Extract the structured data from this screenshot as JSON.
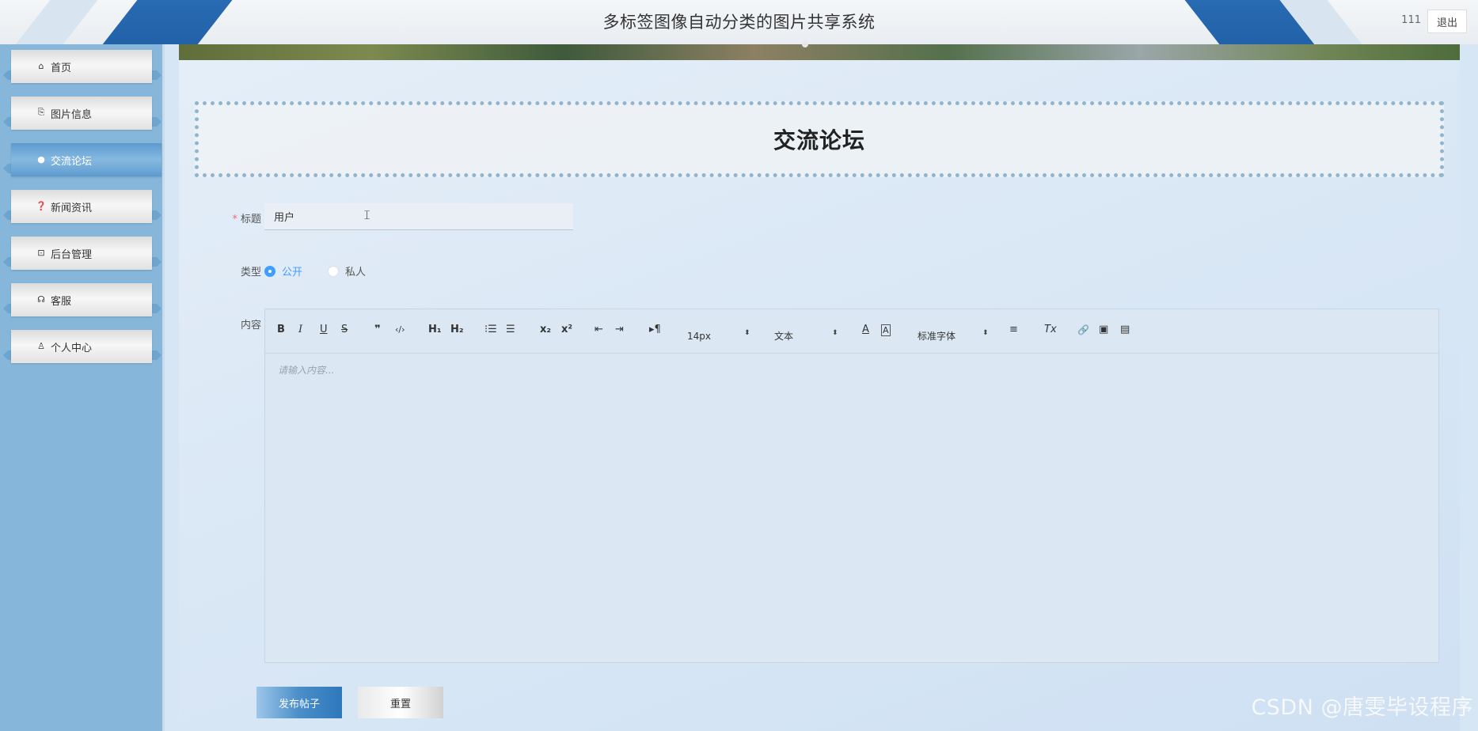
{
  "header": {
    "title": "多标签图像自动分类的图片共享系统",
    "username": "111",
    "logout_label": "退出"
  },
  "sidebar": {
    "items": [
      {
        "label": "首页",
        "icon": "home-icon",
        "active": false
      },
      {
        "label": "图片信息",
        "icon": "bag-icon",
        "active": false
      },
      {
        "label": "交流论坛",
        "icon": "info-icon",
        "active": true
      },
      {
        "label": "新闻资讯",
        "icon": "question-icon",
        "active": false
      },
      {
        "label": "后台管理",
        "icon": "box-icon",
        "active": false
      },
      {
        "label": "客服",
        "icon": "headset-icon",
        "active": false
      },
      {
        "label": "个人中心",
        "icon": "user-icon",
        "active": false
      }
    ]
  },
  "page": {
    "heading": "交流论坛"
  },
  "form": {
    "title_label": "标题",
    "title_required_mark": "*",
    "title_value": "用户",
    "type_label": "类型",
    "type_options": [
      {
        "label": "公开",
        "selected": true
      },
      {
        "label": "私人",
        "selected": false
      }
    ],
    "content_label": "内容",
    "content_placeholder": "请输入内容...",
    "submit_label": "发布帖子",
    "reset_label": "重置"
  },
  "editor_toolbar": {
    "bold": "B",
    "italic": "I",
    "underline": "U",
    "strike": "S",
    "blockquote": "❞",
    "code": "‹/›",
    "h1": "H₁",
    "h2": "H₂",
    "ordered_list": "⁝☰",
    "bullet_list": "☰",
    "subscript": "x₂",
    "superscript": "x²",
    "outdent": "⇤",
    "indent": "⇥",
    "direction": "▸¶",
    "font_size_value": "14px",
    "header_value": "文本",
    "font_family_value": "标准字体",
    "font_color": "A",
    "background_color": "A",
    "align": "≡",
    "clean": "Tx",
    "link": "🔗",
    "image": "▣",
    "video": "▤"
  },
  "watermark": "CSDN @唐雯毕设程序",
  "colors": {
    "sidebar_bg": "#86b7da",
    "accent": "#409eff",
    "header_stripe": "#1f5fa6"
  }
}
